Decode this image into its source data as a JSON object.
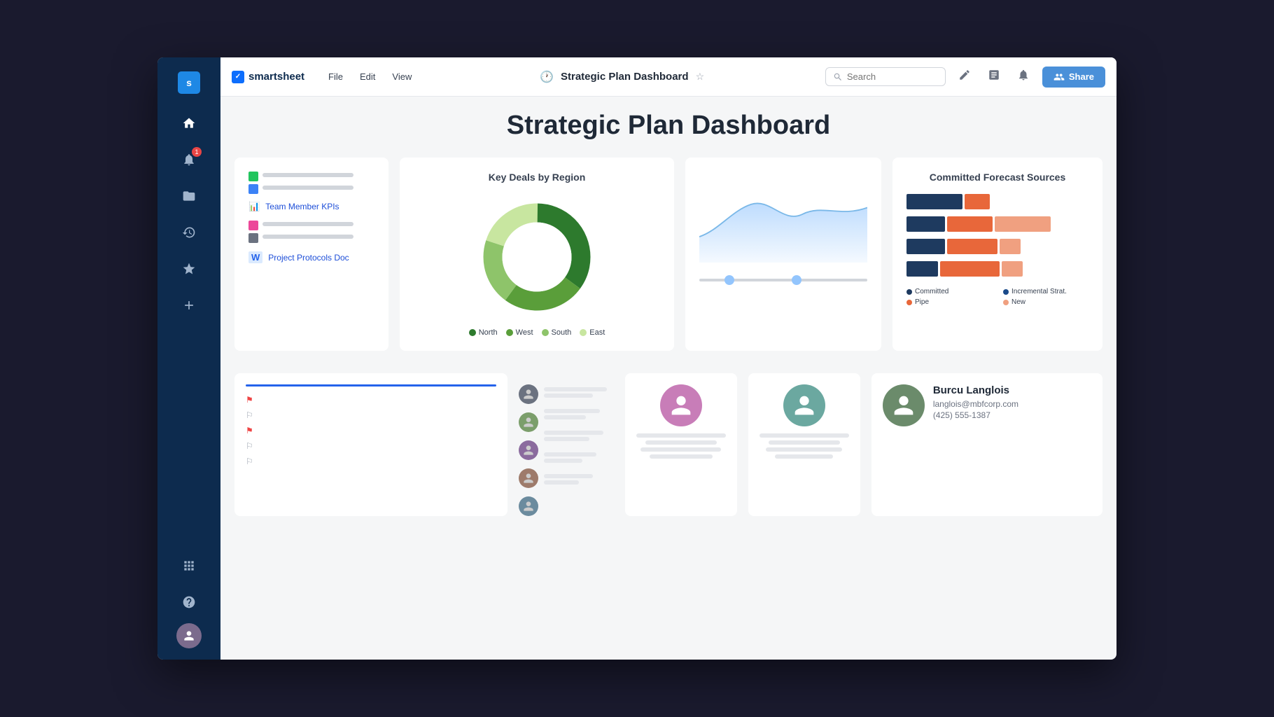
{
  "app": {
    "name": "smartsheet",
    "title": "Strategic Plan Dashboard",
    "title_icon": "🕐"
  },
  "topbar": {
    "nav": [
      "File",
      "Edit",
      "View"
    ],
    "search_placeholder": "Search",
    "share_label": "Share"
  },
  "sidebar": {
    "icons": [
      {
        "name": "home",
        "symbol": "⌂",
        "active": true
      },
      {
        "name": "bell",
        "symbol": "🔔",
        "badge": "1"
      },
      {
        "name": "folder",
        "symbol": "📁"
      },
      {
        "name": "clock",
        "symbol": "🕐"
      },
      {
        "name": "star",
        "symbol": "★"
      },
      {
        "name": "plus",
        "symbol": "+"
      },
      {
        "name": "grid",
        "symbol": "⊞"
      },
      {
        "name": "help",
        "symbol": "?"
      }
    ]
  },
  "dashboard": {
    "title": "Strategic Plan Dashboard",
    "chart1": {
      "title": "Key Deals by Region",
      "donut": {
        "segments": [
          {
            "label": "North",
            "color": "#2d7a2d",
            "pct": 35
          },
          {
            "label": "West",
            "color": "#5a9e3a",
            "pct": 25
          },
          {
            "label": "South",
            "color": "#8ec46a",
            "pct": 20
          },
          {
            "label": "East",
            "color": "#c8e6a0",
            "pct": 20
          }
        ]
      },
      "legend": [
        {
          "label": "North",
          "color": "#2d7a2d"
        },
        {
          "label": "West",
          "color": "#5a9e3a"
        },
        {
          "label": "South",
          "color": "#8ec46a"
        },
        {
          "label": "East",
          "color": "#c8e6a0"
        }
      ]
    },
    "chart2_title": "Committed Forecast Sources",
    "bar_chart": {
      "rows": [
        {
          "committed": 55,
          "pipe": 25,
          "incremental": 0,
          "new": 0
        },
        {
          "committed": 40,
          "pipe": 45,
          "incremental": 0,
          "new": 70
        },
        {
          "committed": 40,
          "pipe": 50,
          "incremental": 0,
          "new": 30
        },
        {
          "committed": 30,
          "pipe": 60,
          "incremental": 0,
          "new": 30
        }
      ],
      "legend": [
        {
          "label": "Committed",
          "color": "#1e3a5f"
        },
        {
          "label": "Incremental Strat.",
          "color": "#1a4a8a"
        },
        {
          "label": "Pipe",
          "color": "#e8673a"
        },
        {
          "label": "New",
          "color": "#f0a080"
        }
      ]
    },
    "files": [
      {
        "label": "Team Member KPIs",
        "icon": "📊",
        "color": "#f59e0b"
      },
      {
        "label": "Project Protocols Doc",
        "icon": "W",
        "color": "#2563eb"
      }
    ],
    "contact": {
      "name": "Burcu Langlois",
      "email": "langlois@mbfcorp.com",
      "phone": "(425) 555-1387"
    }
  }
}
